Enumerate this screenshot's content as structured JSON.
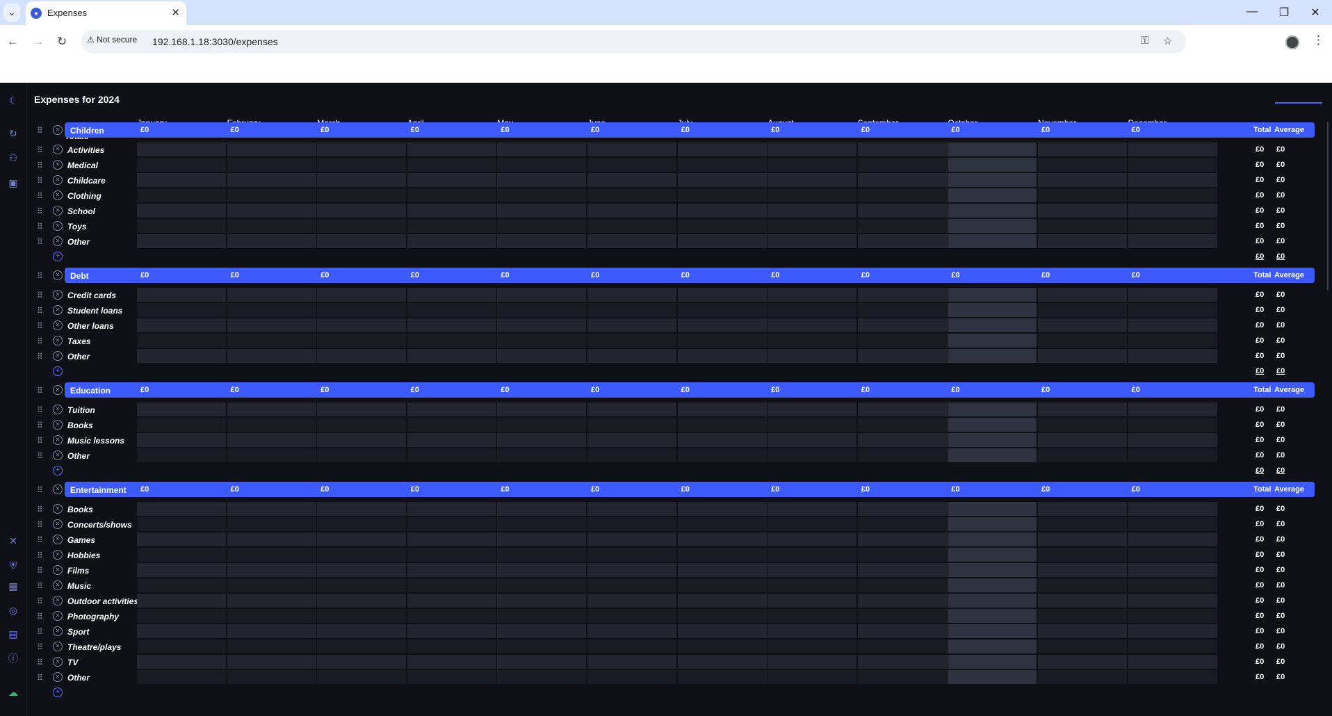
{
  "browser": {
    "tab_title": "Expenses",
    "url": "192.168.1.18:3030/expenses",
    "security_label": "Not secure"
  },
  "page": {
    "title": "Expenses for 2024",
    "totals_label": "Totals",
    "months": [
      "January",
      "February",
      "March",
      "April",
      "May",
      "June",
      "July",
      "August",
      "September",
      "October",
      "November",
      "December"
    ],
    "monthly_totals": [
      "£0",
      "£0",
      "£0",
      "£0",
      "£0",
      "£0",
      "£0",
      "£0",
      "£0",
      "£0",
      "£0",
      "£0"
    ],
    "total_header": "Total",
    "average_header": "Average"
  },
  "categories": [
    {
      "name": "Children",
      "month_totals": [
        "£0",
        "£0",
        "£0",
        "£0",
        "£0",
        "£0",
        "£0",
        "£0",
        "£0",
        "£0",
        "£0",
        "£0"
      ],
      "items": [
        {
          "label": "Activities",
          "total": "£0",
          "average": "£0"
        },
        {
          "label": "Medical",
          "total": "£0",
          "average": "£0"
        },
        {
          "label": "Childcare",
          "total": "£0",
          "average": "£0"
        },
        {
          "label": "Clothing",
          "total": "£0",
          "average": "£0"
        },
        {
          "label": "School",
          "total": "£0",
          "average": "£0"
        },
        {
          "label": "Toys",
          "total": "£0",
          "average": "£0"
        },
        {
          "label": "Other",
          "total": "£0",
          "average": "£0"
        }
      ],
      "sum_total": "£0",
      "sum_average": "£0"
    },
    {
      "name": "Debt",
      "month_totals": [
        "£0",
        "£0",
        "£0",
        "£0",
        "£0",
        "£0",
        "£0",
        "£0",
        "£0",
        "£0",
        "£0",
        "£0"
      ],
      "items": [
        {
          "label": "Credit cards",
          "total": "£0",
          "average": "£0"
        },
        {
          "label": "Student loans",
          "total": "£0",
          "average": "£0"
        },
        {
          "label": "Other loans",
          "total": "£0",
          "average": "£0"
        },
        {
          "label": "Taxes",
          "total": "£0",
          "average": "£0"
        },
        {
          "label": "Other",
          "total": "£0",
          "average": "£0"
        }
      ],
      "sum_total": "£0",
      "sum_average": "£0"
    },
    {
      "name": "Education",
      "month_totals": [
        "£0",
        "£0",
        "£0",
        "£0",
        "£0",
        "£0",
        "£0",
        "£0",
        "£0",
        "£0",
        "£0",
        "£0"
      ],
      "items": [
        {
          "label": "Tuition",
          "total": "£0",
          "average": "£0"
        },
        {
          "label": "Books",
          "total": "£0",
          "average": "£0"
        },
        {
          "label": "Music lessons",
          "total": "£0",
          "average": "£0"
        },
        {
          "label": "Other",
          "total": "£0",
          "average": "£0"
        }
      ],
      "sum_total": "£0",
      "sum_average": "£0"
    },
    {
      "name": "Entertainment",
      "month_totals": [
        "£0",
        "£0",
        "£0",
        "£0",
        "£0",
        "£0",
        "£0",
        "£0",
        "£0",
        "£0",
        "£0",
        "£0"
      ],
      "items": [
        {
          "label": "Books",
          "total": "£0",
          "average": "£0"
        },
        {
          "label": "Concerts/shows",
          "total": "£0",
          "average": "£0"
        },
        {
          "label": "Games",
          "total": "£0",
          "average": "£0"
        },
        {
          "label": "Hobbies",
          "total": "£0",
          "average": "£0"
        },
        {
          "label": "Films",
          "total": "£0",
          "average": "£0"
        },
        {
          "label": "Music",
          "total": "£0",
          "average": "£0"
        },
        {
          "label": "Outdoor activities",
          "total": "£0",
          "average": "£0"
        },
        {
          "label": "Photography",
          "total": "£0",
          "average": "£0"
        },
        {
          "label": "Sport",
          "total": "£0",
          "average": "£0"
        },
        {
          "label": "Theatre/plays",
          "total": "£0",
          "average": "£0"
        },
        {
          "label": "TV",
          "total": "£0",
          "average": "£0"
        },
        {
          "label": "Other",
          "total": "£0",
          "average": "£0"
        }
      ],
      "sum_total": "",
      "sum_average": ""
    }
  ],
  "colors": {
    "accent": "#3d5afe",
    "background": "#0f1116",
    "cell": "#23262f",
    "cell_highlight": "#2f3340"
  }
}
